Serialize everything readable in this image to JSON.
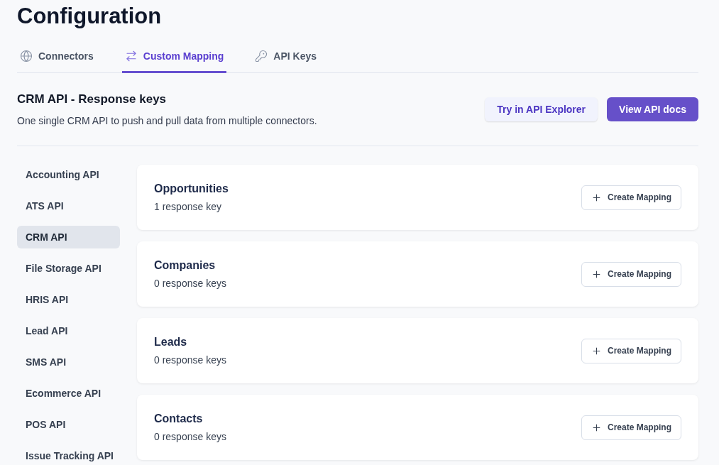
{
  "page_title": "Configuration",
  "tabs": [
    {
      "label": "Connectors",
      "selected": false
    },
    {
      "label": "Custom Mapping",
      "selected": true
    },
    {
      "label": "API Keys",
      "selected": false
    }
  ],
  "section": {
    "title": "CRM API - Response keys",
    "description": "One single CRM API to push and pull data from multiple connectors.",
    "buttons": [
      {
        "label": "Try in API Explorer",
        "kind": "secondary"
      },
      {
        "label": "View API docs",
        "kind": "primary"
      }
    ]
  },
  "sidebar": {
    "items": [
      {
        "label": "Accounting API",
        "selected": false
      },
      {
        "label": "ATS API",
        "selected": false
      },
      {
        "label": "CRM API",
        "selected": true
      },
      {
        "label": "File Storage API",
        "selected": false
      },
      {
        "label": "HRIS API",
        "selected": false
      },
      {
        "label": "Lead API",
        "selected": false
      },
      {
        "label": "SMS API",
        "selected": false
      },
      {
        "label": "Ecommerce API",
        "selected": false
      },
      {
        "label": "POS API",
        "selected": false
      },
      {
        "label": "Issue Tracking API",
        "selected": false
      }
    ]
  },
  "resources": [
    {
      "name": "Opportunities",
      "count": "1 response key",
      "button": "Create Mapping"
    },
    {
      "name": "Companies",
      "count": "0 response keys",
      "button": "Create Mapping"
    },
    {
      "name": "Leads",
      "count": "0 response keys",
      "button": "Create Mapping"
    },
    {
      "name": "Contacts",
      "count": "0 response keys",
      "button": "Create Mapping"
    }
  ]
}
